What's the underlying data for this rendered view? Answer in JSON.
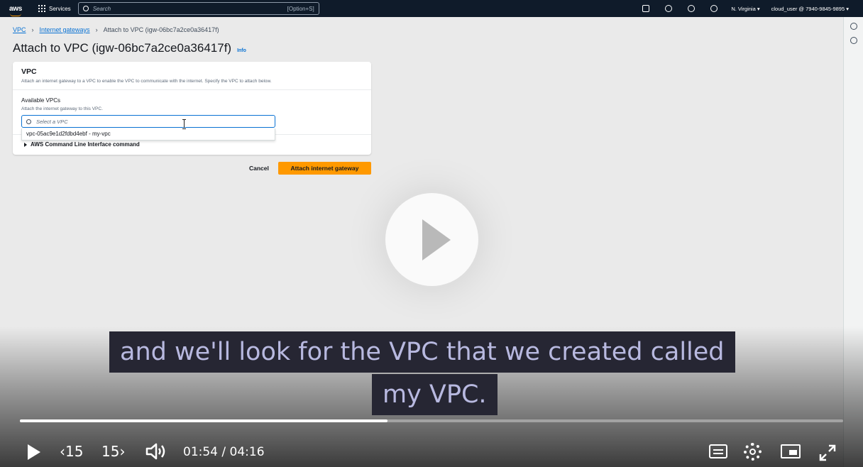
{
  "topnav": {
    "logo": "aws",
    "services_label": "Services",
    "search_placeholder": "Search",
    "search_shortcut": "[Option+S]",
    "region": "N. Virginia ▾",
    "account": "cloud_user @ 7940-9845-9895 ▾"
  },
  "breadcrumb": {
    "item1": "VPC",
    "item2": "Internet gateways",
    "current": "Attach to VPC (igw-06bc7a2ce0a36417f)"
  },
  "page": {
    "title": "Attach to VPC (igw-06bc7a2ce0a36417f)",
    "info": "Info"
  },
  "panel": {
    "title": "VPC",
    "description": "Attach an internet gateway to a VPC to enable the VPC to communicate with the internet. Specify the VPC to attach below.",
    "field_label": "Available VPCs",
    "field_description": "Attach the internet gateway to this VPC.",
    "input_placeholder": "Select a VPC",
    "dropdown_option": "vpc-05ac9e1d2fdbd4ebf - my-vpc",
    "cli_label": "AWS Command Line Interface command"
  },
  "actions": {
    "cancel": "Cancel",
    "attach": "Attach internet gateway"
  },
  "video": {
    "caption_line1": "and we'll look for the VPC that we created called",
    "caption_line2": "my VPC.",
    "skip_back": "‹15",
    "skip_forward": "15›",
    "time": "01:54 / 04:16",
    "progress_fraction": 0.4465
  },
  "colors": {
    "nav_bg": "#0f1b2a",
    "primary_button": "#ff9900",
    "link": "#0972d3"
  }
}
